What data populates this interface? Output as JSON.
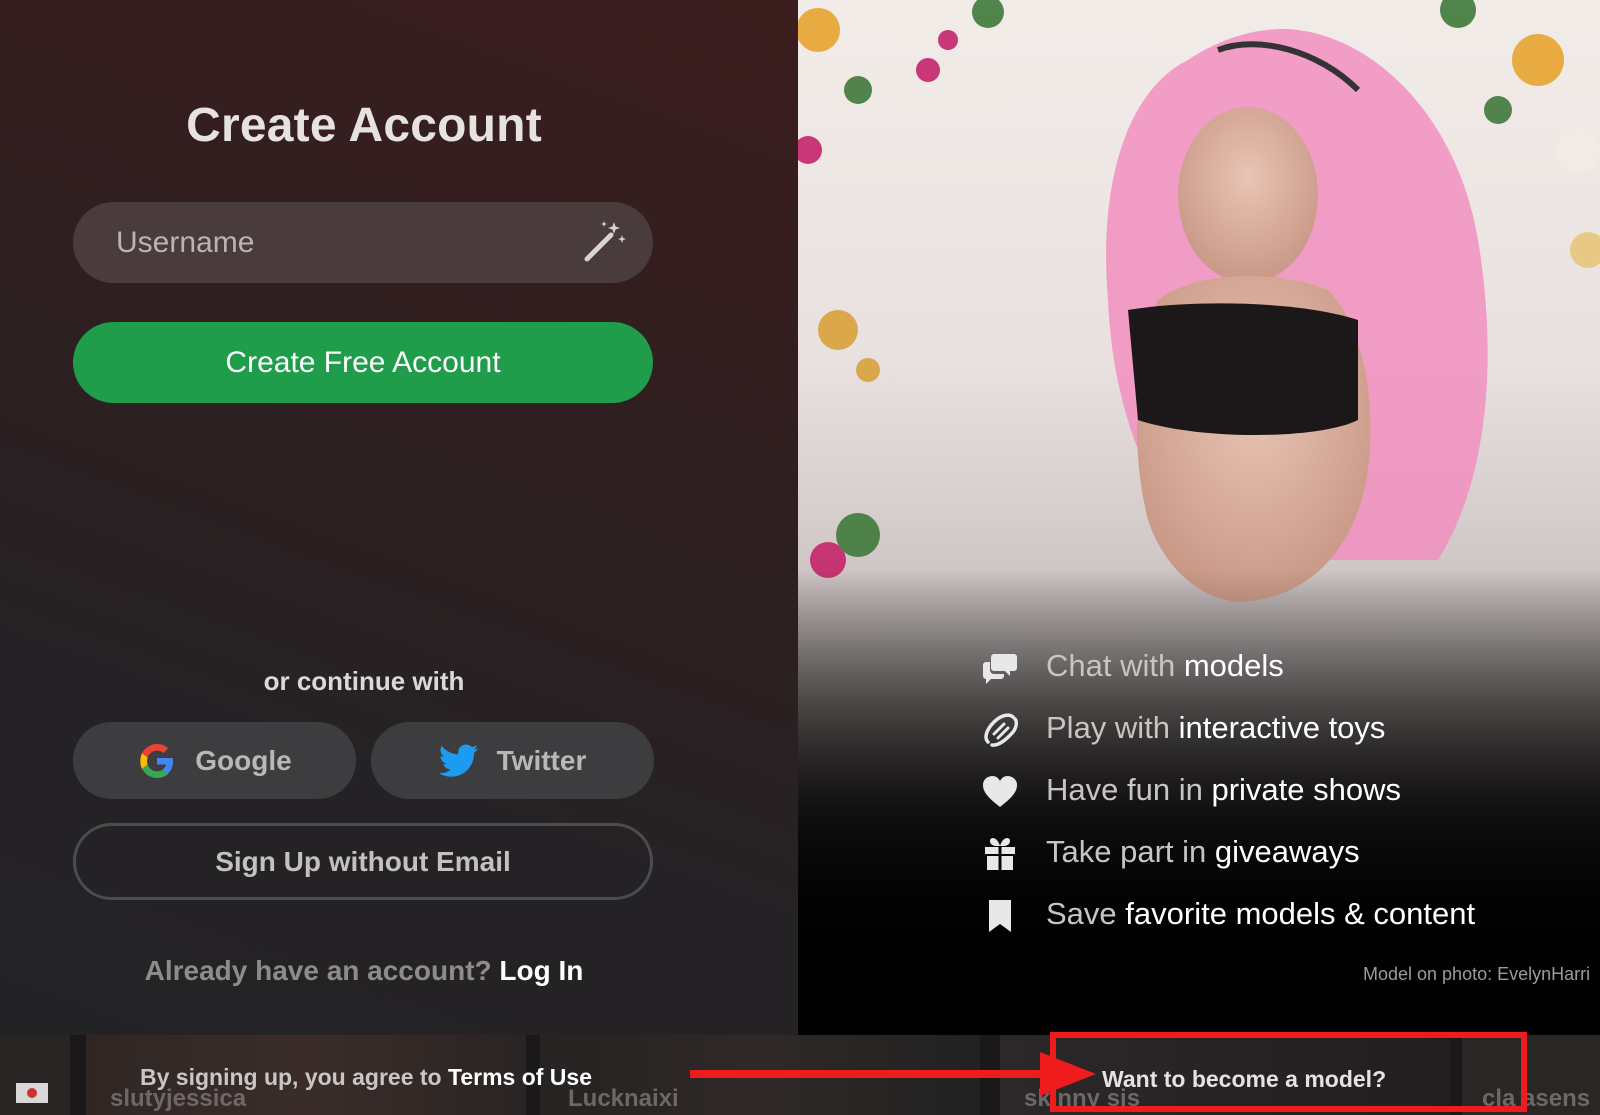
{
  "signup": {
    "title": "Create Account",
    "username_placeholder": "Username",
    "create_button": "Create Free Account",
    "or_continue": "or continue with",
    "google_label": "Google",
    "twitter_label": "Twitter",
    "no_email_button": "Sign Up without Email",
    "already_text": "Already have an account?",
    "login_link": "Log In"
  },
  "features": [
    {
      "icon": "chat-bubbles-icon",
      "dim": "Chat with",
      "bright": "models"
    },
    {
      "icon": "toy-icon",
      "dim": "Play with",
      "bright": "interactive toys"
    },
    {
      "icon": "heart-icon",
      "dim": "Have fun in",
      "bright": "private shows"
    },
    {
      "icon": "gift-icon",
      "dim": "Take part in",
      "bright": "giveaways"
    },
    {
      "icon": "bookmark-icon",
      "dim": "Save",
      "bright": "favorite models & content"
    }
  ],
  "photo_credit": "Model on photo: EvelynHarri",
  "footer": {
    "terms_prefix": "By signing up, you agree to",
    "terms_link": "Terms of Use",
    "become_model": "Want to become a model?"
  },
  "background_tiles": [
    "slutyjessica",
    "Lucknaixi",
    "sk nny sis",
    "cla asens"
  ],
  "colors": {
    "accent_green": "#1f9d4b",
    "annotation_red": "#ee1c1c",
    "twitter_blue": "#1d9bf0"
  }
}
